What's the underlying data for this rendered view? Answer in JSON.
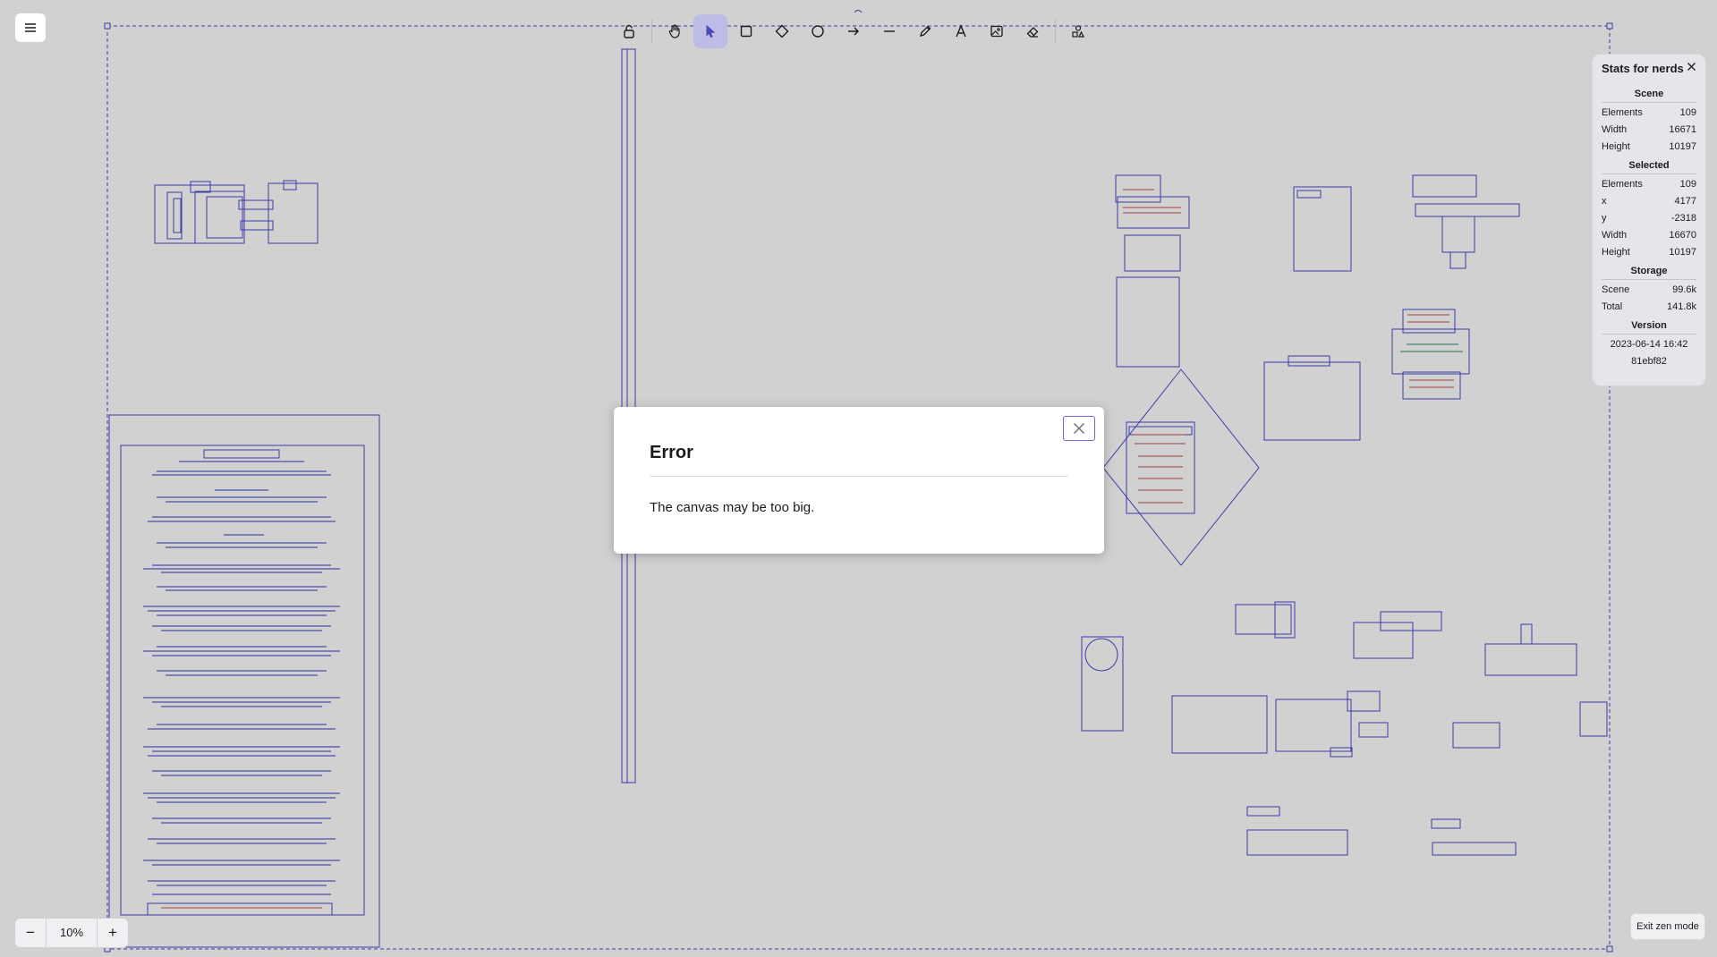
{
  "colors": {
    "sketch": "#4a4ac8",
    "accent": "#6965db",
    "active_tool_bg": "#bcbce6"
  },
  "toolbar": {
    "tools": [
      {
        "name": "lock-icon",
        "active": false
      },
      {
        "name": "hand-icon",
        "active": false
      },
      {
        "name": "selection-arrow-icon",
        "active": true
      },
      {
        "name": "rectangle-icon",
        "active": false
      },
      {
        "name": "diamond-icon",
        "active": false
      },
      {
        "name": "ellipse-icon",
        "active": false
      },
      {
        "name": "arrow-icon",
        "active": false
      },
      {
        "name": "line-icon",
        "active": false
      },
      {
        "name": "pencil-icon",
        "active": false
      },
      {
        "name": "text-icon",
        "active": false
      },
      {
        "name": "image-icon",
        "active": false
      },
      {
        "name": "eraser-icon",
        "active": false
      },
      {
        "name": "shapes-library-icon",
        "active": false
      }
    ]
  },
  "stats": {
    "title": "Stats for nerds",
    "scene_header": "Scene",
    "scene": [
      {
        "label": "Elements",
        "value": "109"
      },
      {
        "label": "Width",
        "value": "16671"
      },
      {
        "label": "Height",
        "value": "10197"
      }
    ],
    "selected_header": "Selected",
    "selected": [
      {
        "label": "Elements",
        "value": "109"
      },
      {
        "label": "x",
        "value": "4177"
      },
      {
        "label": "y",
        "value": "-2318"
      },
      {
        "label": "Width",
        "value": "16670"
      },
      {
        "label": "Height",
        "value": "10197"
      }
    ],
    "storage_header": "Storage",
    "storage": [
      {
        "label": "Scene",
        "value": "99.6k"
      },
      {
        "label": "Total",
        "value": "141.8k"
      }
    ],
    "version_header": "Version",
    "version_date": "2023-06-14 16:42",
    "version_hash": "81ebf82"
  },
  "zoom": {
    "minus": "−",
    "value": "10%",
    "plus": "+"
  },
  "exit_zen_label": "Exit zen mode",
  "dialog": {
    "title": "Error",
    "message": "The canvas may be too big."
  }
}
